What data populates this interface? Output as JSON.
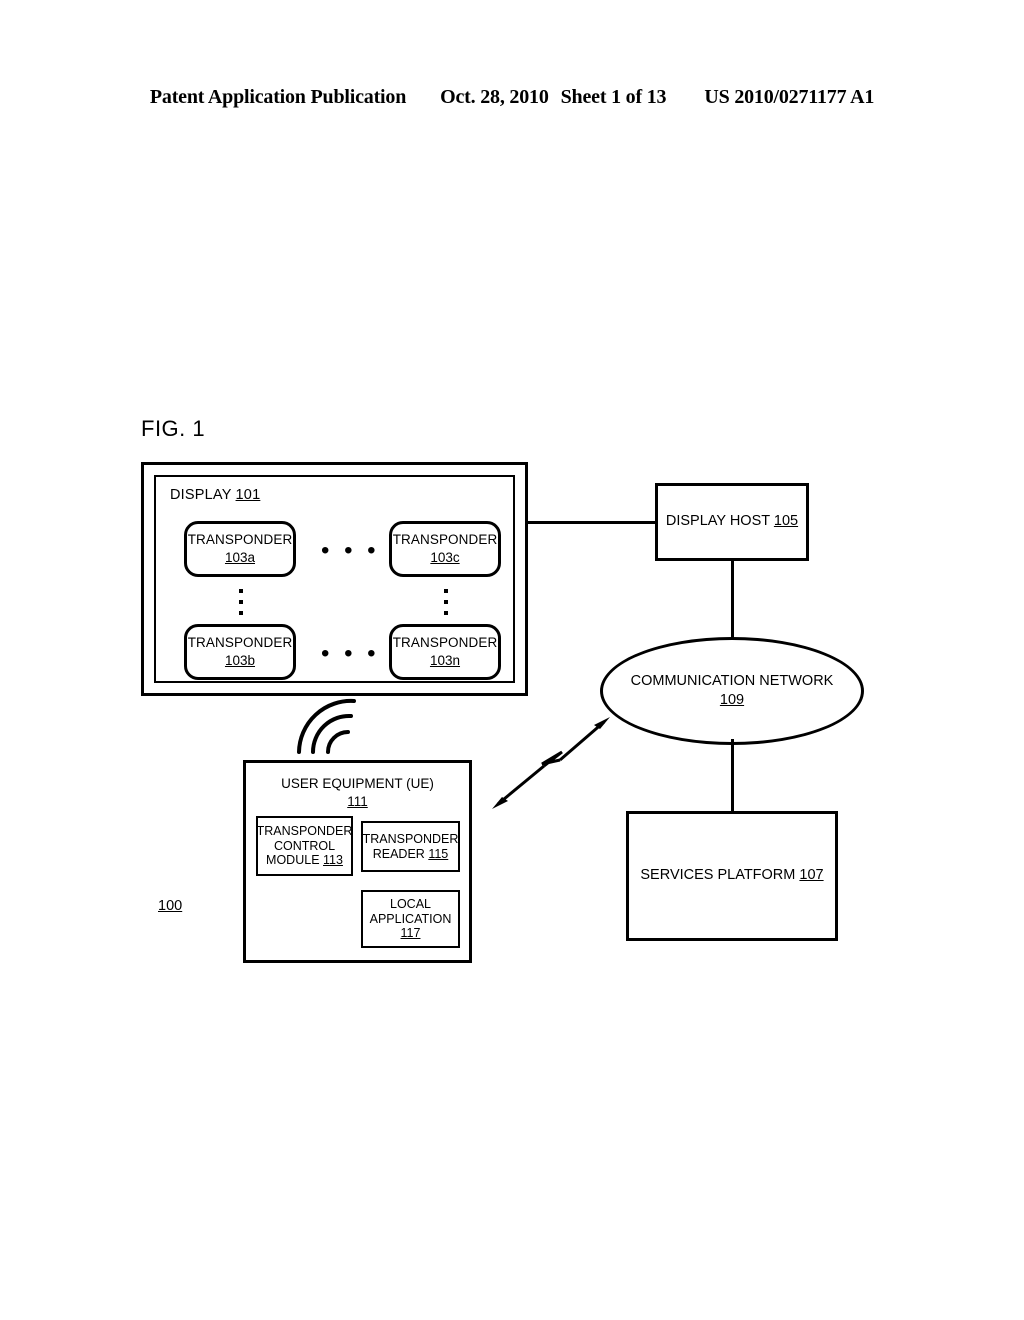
{
  "header": {
    "publication": "Patent Application Publication",
    "date": "Oct. 28, 2010",
    "sheet": "Sheet 1 of 13",
    "patent_number": "US 2010/0271177 A1"
  },
  "figure": {
    "label": "FIG. 1",
    "system_ref": "100"
  },
  "display_panel": {
    "title_text": "DISPLAY",
    "title_ref": "101",
    "transponders": [
      {
        "label": "TRANSPONDER",
        "ref": "103a"
      },
      {
        "label": "TRANSPONDER",
        "ref": "103c"
      },
      {
        "label": "TRANSPONDER",
        "ref": "103b"
      },
      {
        "label": "TRANSPONDER",
        "ref": "103n"
      }
    ],
    "horizontal_ellipsis_top": "• • •",
    "horizontal_ellipsis_bottom": "• • •"
  },
  "display_host": {
    "label": "DISPLAY HOST",
    "ref": "105"
  },
  "network": {
    "label": "COMMUNICATION NETWORK",
    "ref": "109"
  },
  "services_platform": {
    "label": "SERVICES PLATFORM",
    "ref": "107"
  },
  "user_equipment": {
    "title": "USER EQUIPMENT (UE)",
    "ref": "111",
    "modules": [
      {
        "line1": "TRANSPONDER",
        "line2": "CONTROL",
        "line3": "MODULE",
        "ref": "113"
      },
      {
        "line1": "TRANSPONDER",
        "line2": "READER",
        "ref": "115"
      },
      {
        "line1": "LOCAL",
        "line2": "APPLICATION",
        "ref": "117"
      }
    ]
  },
  "icons": {
    "wireless_signal": "wireless-signal-icon",
    "wireless_link_arrow": "wireless-link-arrow-icon"
  },
  "colors": {
    "ink": "#000000",
    "paper": "#ffffff"
  }
}
